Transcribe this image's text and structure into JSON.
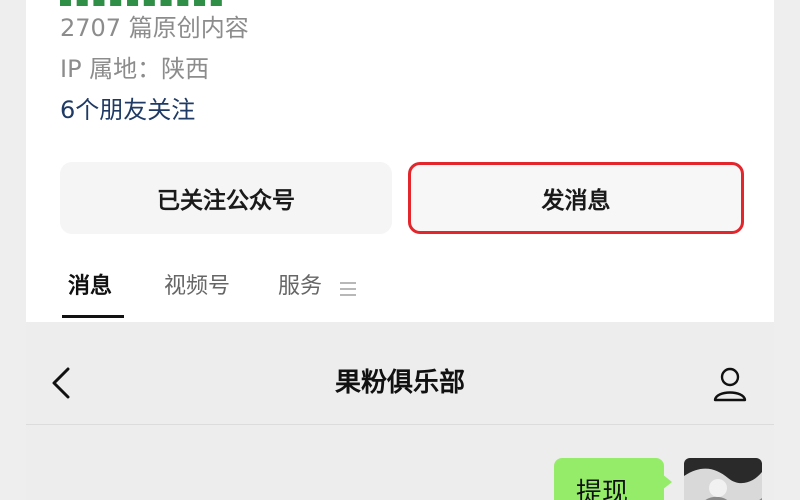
{
  "profile": {
    "articles_text": "2707 篇原创内容",
    "ip_text": "IP 属地：陕西",
    "friends_text": "6个朋友关注"
  },
  "buttons": {
    "followed_label": "已关注公众号",
    "message_label": "发消息"
  },
  "tabs": [
    {
      "label": "消息",
      "active": true
    },
    {
      "label": "视频号",
      "active": false
    },
    {
      "label": "服务",
      "active": false
    }
  ],
  "chat": {
    "title": "果粉俱乐部",
    "outgoing_message": "提现"
  },
  "colors": {
    "highlight_border": "#e2262c",
    "bubble_green": "#95ec69",
    "link_blue": "#1f3a64"
  },
  "icons": {
    "menu": "menu-icon",
    "back": "back-icon",
    "profile": "profile-icon"
  }
}
